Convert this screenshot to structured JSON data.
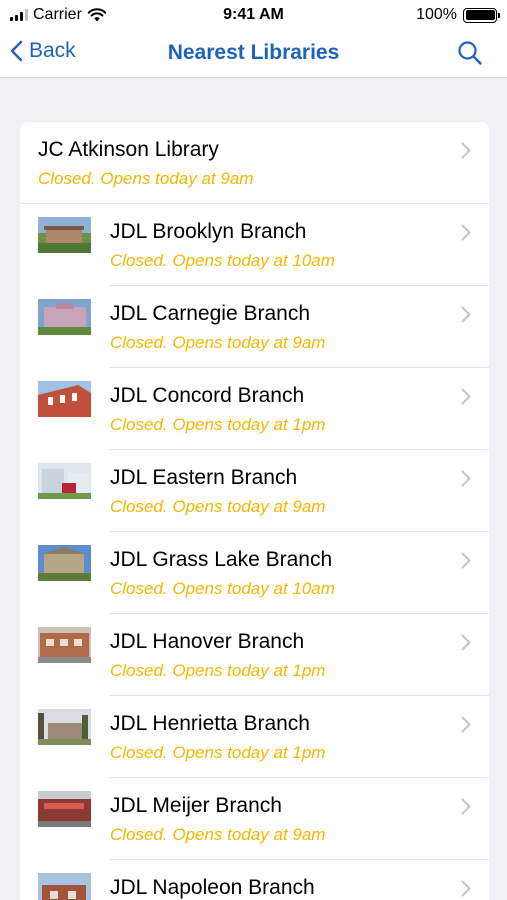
{
  "status_bar": {
    "carrier": "Carrier",
    "time": "9:41 AM",
    "battery": "100%"
  },
  "nav": {
    "back_label": "Back",
    "title": "Nearest Libraries"
  },
  "colors": {
    "accent": "#1f63b8",
    "status_closed": "#f5b600",
    "background": "#efeff4"
  },
  "libraries": [
    {
      "name": "JC Atkinson Library",
      "status": "Closed. Opens today at 9am"
    },
    {
      "name": "JDL Brooklyn Branch",
      "status": "Closed. Opens today at 10am"
    },
    {
      "name": "JDL Carnegie Branch",
      "status": "Closed. Opens today at 9am"
    },
    {
      "name": "JDL Concord Branch",
      "status": "Closed. Opens today at 1pm"
    },
    {
      "name": "JDL Eastern Branch",
      "status": "Closed. Opens today at 9am"
    },
    {
      "name": "JDL Grass Lake Branch",
      "status": "Closed. Opens today at 10am"
    },
    {
      "name": "JDL Hanover Branch",
      "status": "Closed. Opens today at 1pm"
    },
    {
      "name": "JDL Henrietta Branch",
      "status": "Closed. Opens today at 1pm"
    },
    {
      "name": "JDL Meijer Branch",
      "status": "Closed. Opens today at 9am"
    },
    {
      "name": "JDL Napoleon Branch",
      "status": ""
    }
  ]
}
